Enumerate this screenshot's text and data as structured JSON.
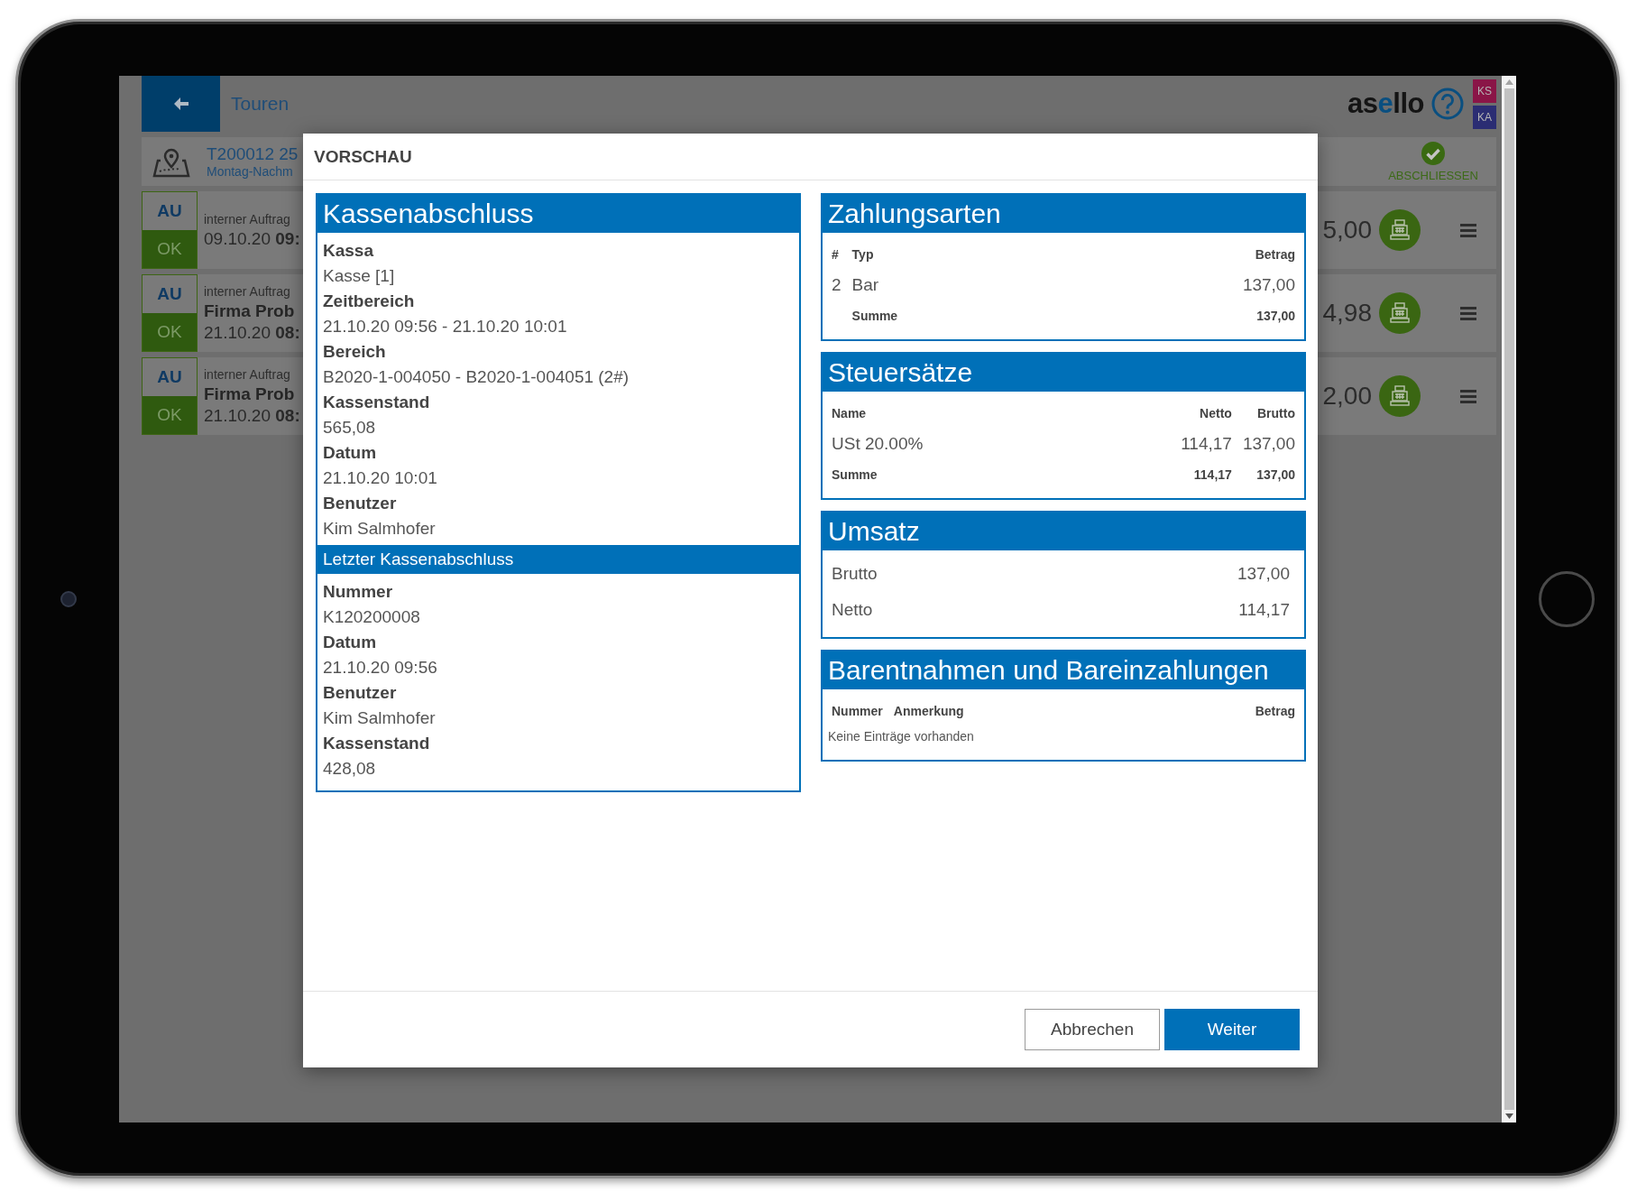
{
  "app": {
    "page_title": "Touren",
    "logo": "asello",
    "user_badges": [
      {
        "label": "KS",
        "color": "#8a1547"
      },
      {
        "label": "KA",
        "color": "#2b2d73"
      }
    ],
    "tour": {
      "number": "T200012 25",
      "subtitle": "Montag-Nachm",
      "action": "ABSCHLIESSEN"
    },
    "orders": [
      {
        "type": "AU",
        "status": "OK",
        "category": "interner Auftrag",
        "date": "09.10.20 **09:**",
        "amount": "5,00"
      },
      {
        "type": "AU",
        "status": "OK",
        "category": "interner Auftrag",
        "customer": "Firma Prob",
        "date": "21.10.20 **08:**",
        "amount": "4,98"
      },
      {
        "type": "AU",
        "status": "OK",
        "category": "interner Auftrag",
        "customer": "Firma Prob",
        "date": "21.10.20 **08:**",
        "amount": "2,00"
      }
    ]
  },
  "dialog": {
    "title": "VORSCHAU",
    "summary": {
      "title": "Kassenabschluss",
      "fields": [
        {
          "label": "Kassa",
          "value": "Kasse [1]"
        },
        {
          "label": "Zeitbereich",
          "value": "21.10.20 09:56 - 21.10.20 10:01"
        },
        {
          "label": "Bereich",
          "value": "B2020-1-004050 - B2020-1-004051 (2#)"
        },
        {
          "label": "Kassenstand",
          "value": "565,08"
        },
        {
          "label": "Datum",
          "value": "21.10.20 10:01"
        },
        {
          "label": "Benutzer",
          "value": "Kim Salmhofer"
        }
      ],
      "last": {
        "title": "Letzter Kassenabschluss",
        "fields": [
          {
            "label": "Nummer",
            "value": "K120200008"
          },
          {
            "label": "Datum",
            "value": "21.10.20 09:56"
          },
          {
            "label": "Benutzer",
            "value": "Kim Salmhofer"
          },
          {
            "label": "Kassenstand",
            "value": "428,08"
          }
        ]
      }
    },
    "tables": [
      {
        "title": "Zahlungsarten",
        "columns": [
          "#",
          "Typ",
          "Betrag"
        ],
        "rows": [
          [
            "2",
            "Bar",
            "137,00"
          ]
        ],
        "total": {
          "label": "Summe",
          "values": [
            "137,00"
          ]
        }
      },
      {
        "title": "Steuersätze",
        "columns": [
          "Name",
          "Netto",
          "Brutto"
        ],
        "rows": [
          [
            "USt 20.00%",
            "114,17",
            "137,00"
          ]
        ],
        "total": {
          "label": "Summe",
          "values": [
            "114,17",
            "137,00"
          ]
        }
      },
      {
        "title": "Umsatz",
        "rows": [
          [
            "Brutto",
            "137,00"
          ],
          [
            "Netto",
            "114,17"
          ]
        ]
      },
      {
        "title": "Barentnahmen und Bareinzahlungen",
        "columns": [
          "Nummer",
          "Anmerkung",
          "Betrag"
        ],
        "empty_text": "Keine Einträge vorhanden"
      }
    ],
    "buttons": [
      {
        "label": "Abbrechen",
        "kind": "secondary"
      },
      {
        "label": "Weiter",
        "kind": "primary"
      }
    ]
  }
}
